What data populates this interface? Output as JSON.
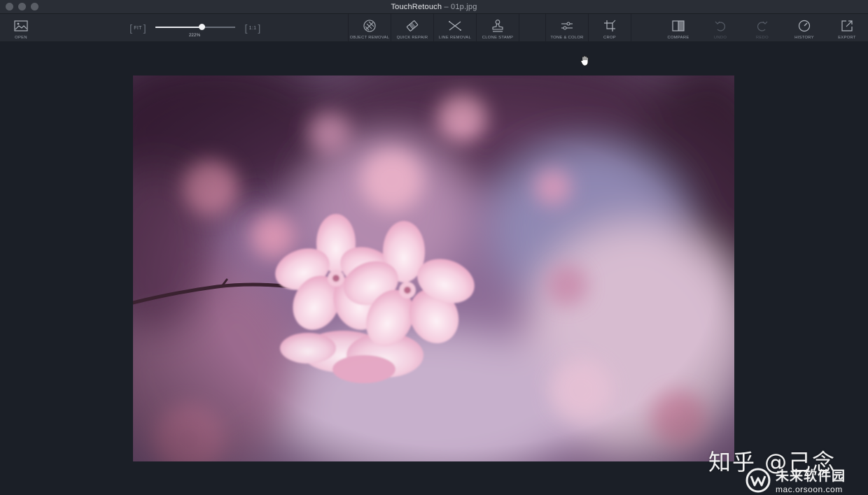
{
  "window": {
    "app_name": "TouchRetouch",
    "separator": "–",
    "file_name": "01p.jpg"
  },
  "toolbar": {
    "open_label": "OPEN",
    "fit_label": "FIT",
    "one_to_one_label": "1:1",
    "zoom_value": "222%",
    "zoom_fraction": 0.58,
    "object_removal_label": "OBJECT REMOVAL",
    "quick_repair_label": "QUICK REPAIR",
    "line_removal_label": "LINE REMOVAL",
    "clone_stamp_label": "CLONE STAMP",
    "tone_color_label": "TONE & COLOR",
    "crop_label": "CROP",
    "compare_label": "COMPARE",
    "undo_label": "UNDO",
    "redo_label": "REDO",
    "history_label": "HISTORY",
    "export_label": "EXPORT"
  },
  "icons": {
    "open": "image-icon",
    "object_removal": "brush-icon",
    "quick_repair": "eraser-icon",
    "line_removal": "line-removal-icon",
    "clone_stamp": "stamp-icon",
    "tone_color": "sliders-icon",
    "crop": "crop-icon",
    "compare": "compare-icon",
    "undo": "undo-icon",
    "redo": "redo-icon",
    "history": "history-icon",
    "export": "export-icon"
  },
  "watermark": {
    "zhihu_text": "知乎 @己念",
    "site_name": "未来软件园",
    "site_url": "mac.orsoon.com"
  },
  "colors": {
    "background": "#1b1f27",
    "toolbar": "#262a32",
    "titlebar": "#2a2e36",
    "label": "#9aa0aa",
    "disabled": "#4f555f"
  }
}
